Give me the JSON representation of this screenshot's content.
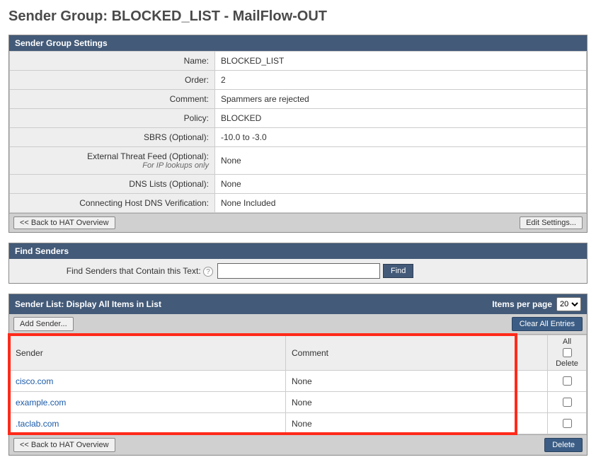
{
  "page": {
    "title": "Sender Group: BLOCKED_LIST - MailFlow-OUT"
  },
  "settings": {
    "header": "Sender Group Settings",
    "rows": {
      "name_label": "Name:",
      "name_value": "BLOCKED_LIST",
      "order_label": "Order:",
      "order_value": "2",
      "comment_label": "Comment:",
      "comment_value": "Spammers are rejected",
      "policy_label": "Policy:",
      "policy_value": "BLOCKED",
      "sbrs_label": "SBRS (Optional):",
      "sbrs_value": "-10.0 to -3.0",
      "etf_label": "External Threat Feed (Optional):",
      "etf_sub": "For IP lookups only",
      "etf_value": "None",
      "dns_label": "DNS Lists (Optional):",
      "dns_value": "None",
      "chdv_label": "Connecting Host DNS Verification:",
      "chdv_value": "None Included"
    },
    "back_btn": "<< Back to HAT Overview",
    "edit_btn": "Edit Settings..."
  },
  "find": {
    "header": "Find Senders",
    "label": "Find Senders that Contain this Text:",
    "value": "",
    "btn": "Find"
  },
  "list": {
    "header": "Sender List: Display All Items in List",
    "ipp_label": "Items per page",
    "ipp_value": "20",
    "add_btn": "Add Sender...",
    "clear_btn": "Clear All Entries",
    "col_sender": "Sender",
    "col_comment": "Comment",
    "col_all": "All",
    "col_delete": "Delete",
    "rows": [
      {
        "sender": "cisco.com",
        "comment": "None"
      },
      {
        "sender": "example.com",
        "comment": "None"
      },
      {
        "sender": ".taclab.com",
        "comment": "None"
      }
    ],
    "back_btn": "<< Back to HAT Overview",
    "delete_btn": "Delete"
  }
}
